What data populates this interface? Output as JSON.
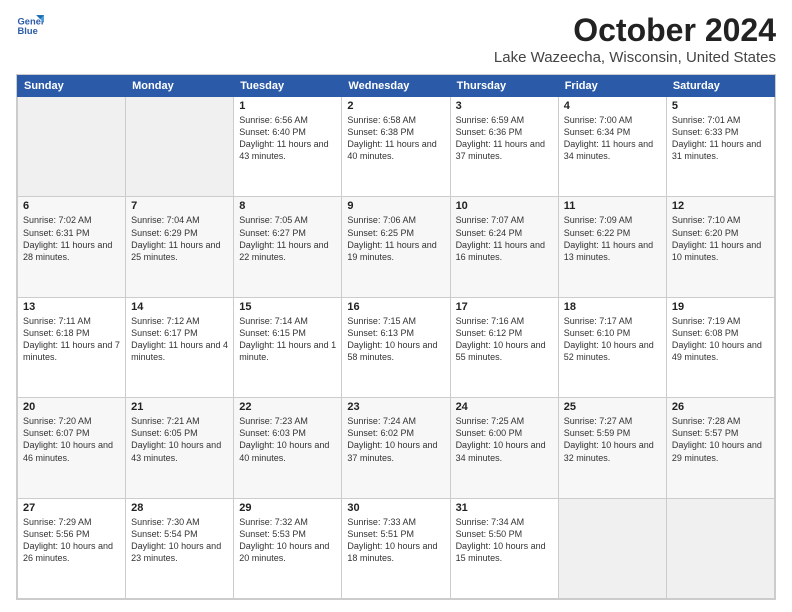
{
  "logo": {
    "line1": "General",
    "line2": "Blue"
  },
  "title": "October 2024",
  "location": "Lake Wazeecha, Wisconsin, United States",
  "weekdays": [
    "Sunday",
    "Monday",
    "Tuesday",
    "Wednesday",
    "Thursday",
    "Friday",
    "Saturday"
  ],
  "weeks": [
    [
      {
        "day": "",
        "content": ""
      },
      {
        "day": "",
        "content": ""
      },
      {
        "day": "1",
        "content": "Sunrise: 6:56 AM\nSunset: 6:40 PM\nDaylight: 11 hours and 43 minutes."
      },
      {
        "day": "2",
        "content": "Sunrise: 6:58 AM\nSunset: 6:38 PM\nDaylight: 11 hours and 40 minutes."
      },
      {
        "day": "3",
        "content": "Sunrise: 6:59 AM\nSunset: 6:36 PM\nDaylight: 11 hours and 37 minutes."
      },
      {
        "day": "4",
        "content": "Sunrise: 7:00 AM\nSunset: 6:34 PM\nDaylight: 11 hours and 34 minutes."
      },
      {
        "day": "5",
        "content": "Sunrise: 7:01 AM\nSunset: 6:33 PM\nDaylight: 11 hours and 31 minutes."
      }
    ],
    [
      {
        "day": "6",
        "content": "Sunrise: 7:02 AM\nSunset: 6:31 PM\nDaylight: 11 hours and 28 minutes."
      },
      {
        "day": "7",
        "content": "Sunrise: 7:04 AM\nSunset: 6:29 PM\nDaylight: 11 hours and 25 minutes."
      },
      {
        "day": "8",
        "content": "Sunrise: 7:05 AM\nSunset: 6:27 PM\nDaylight: 11 hours and 22 minutes."
      },
      {
        "day": "9",
        "content": "Sunrise: 7:06 AM\nSunset: 6:25 PM\nDaylight: 11 hours and 19 minutes."
      },
      {
        "day": "10",
        "content": "Sunrise: 7:07 AM\nSunset: 6:24 PM\nDaylight: 11 hours and 16 minutes."
      },
      {
        "day": "11",
        "content": "Sunrise: 7:09 AM\nSunset: 6:22 PM\nDaylight: 11 hours and 13 minutes."
      },
      {
        "day": "12",
        "content": "Sunrise: 7:10 AM\nSunset: 6:20 PM\nDaylight: 11 hours and 10 minutes."
      }
    ],
    [
      {
        "day": "13",
        "content": "Sunrise: 7:11 AM\nSunset: 6:18 PM\nDaylight: 11 hours and 7 minutes."
      },
      {
        "day": "14",
        "content": "Sunrise: 7:12 AM\nSunset: 6:17 PM\nDaylight: 11 hours and 4 minutes."
      },
      {
        "day": "15",
        "content": "Sunrise: 7:14 AM\nSunset: 6:15 PM\nDaylight: 11 hours and 1 minute."
      },
      {
        "day": "16",
        "content": "Sunrise: 7:15 AM\nSunset: 6:13 PM\nDaylight: 10 hours and 58 minutes."
      },
      {
        "day": "17",
        "content": "Sunrise: 7:16 AM\nSunset: 6:12 PM\nDaylight: 10 hours and 55 minutes."
      },
      {
        "day": "18",
        "content": "Sunrise: 7:17 AM\nSunset: 6:10 PM\nDaylight: 10 hours and 52 minutes."
      },
      {
        "day": "19",
        "content": "Sunrise: 7:19 AM\nSunset: 6:08 PM\nDaylight: 10 hours and 49 minutes."
      }
    ],
    [
      {
        "day": "20",
        "content": "Sunrise: 7:20 AM\nSunset: 6:07 PM\nDaylight: 10 hours and 46 minutes."
      },
      {
        "day": "21",
        "content": "Sunrise: 7:21 AM\nSunset: 6:05 PM\nDaylight: 10 hours and 43 minutes."
      },
      {
        "day": "22",
        "content": "Sunrise: 7:23 AM\nSunset: 6:03 PM\nDaylight: 10 hours and 40 minutes."
      },
      {
        "day": "23",
        "content": "Sunrise: 7:24 AM\nSunset: 6:02 PM\nDaylight: 10 hours and 37 minutes."
      },
      {
        "day": "24",
        "content": "Sunrise: 7:25 AM\nSunset: 6:00 PM\nDaylight: 10 hours and 34 minutes."
      },
      {
        "day": "25",
        "content": "Sunrise: 7:27 AM\nSunset: 5:59 PM\nDaylight: 10 hours and 32 minutes."
      },
      {
        "day": "26",
        "content": "Sunrise: 7:28 AM\nSunset: 5:57 PM\nDaylight: 10 hours and 29 minutes."
      }
    ],
    [
      {
        "day": "27",
        "content": "Sunrise: 7:29 AM\nSunset: 5:56 PM\nDaylight: 10 hours and 26 minutes."
      },
      {
        "day": "28",
        "content": "Sunrise: 7:30 AM\nSunset: 5:54 PM\nDaylight: 10 hours and 23 minutes."
      },
      {
        "day": "29",
        "content": "Sunrise: 7:32 AM\nSunset: 5:53 PM\nDaylight: 10 hours and 20 minutes."
      },
      {
        "day": "30",
        "content": "Sunrise: 7:33 AM\nSunset: 5:51 PM\nDaylight: 10 hours and 18 minutes."
      },
      {
        "day": "31",
        "content": "Sunrise: 7:34 AM\nSunset: 5:50 PM\nDaylight: 10 hours and 15 minutes."
      },
      {
        "day": "",
        "content": ""
      },
      {
        "day": "",
        "content": ""
      }
    ]
  ]
}
